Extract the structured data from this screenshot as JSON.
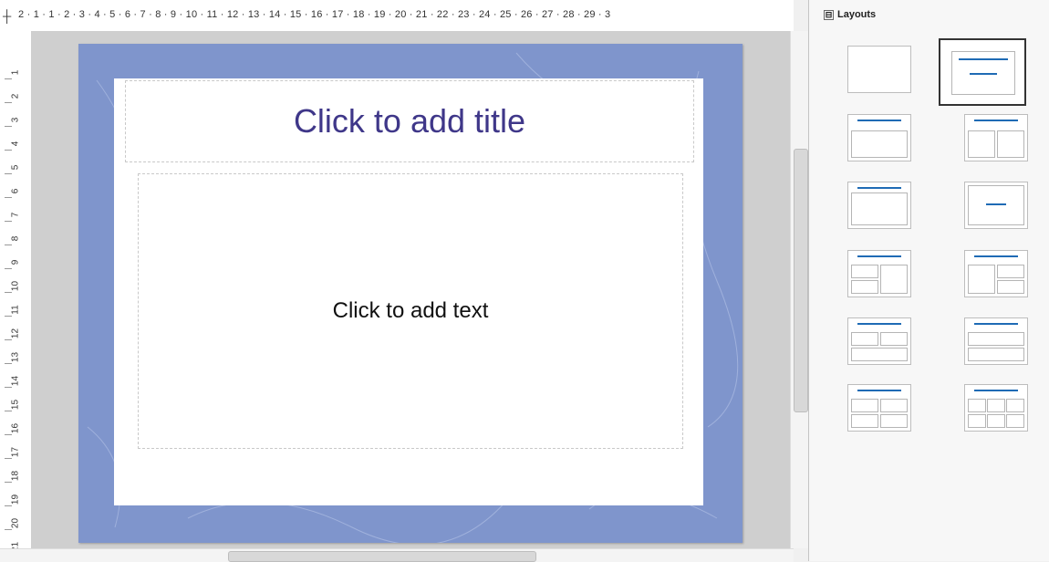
{
  "slide": {
    "title_placeholder": "Click to add title",
    "content_placeholder": "Click to add text"
  },
  "rulers": {
    "horizontal_labels": [
      "2",
      "1",
      "1",
      "2",
      "3",
      "4",
      "5",
      "6",
      "7",
      "8",
      "9",
      "10",
      "11",
      "12",
      "13",
      "14",
      "15",
      "16",
      "17",
      "18",
      "19",
      "20",
      "21",
      "22",
      "23",
      "24",
      "25",
      "26",
      "27",
      "28",
      "29",
      "3"
    ],
    "vertical_labels": [
      "1",
      "2",
      "3",
      "4",
      "5",
      "6",
      "7",
      "8",
      "9",
      "10",
      "11",
      "12",
      "13",
      "14",
      "15",
      "16",
      "17",
      "18",
      "19",
      "20",
      "21"
    ]
  },
  "sidebar": {
    "header": "Layouts",
    "toggle_symbol": "⊟",
    "layouts": [
      {
        "name": "blank"
      },
      {
        "name": "title-content"
      },
      {
        "name": "title-content-2"
      },
      {
        "name": "title-2-content"
      },
      {
        "name": "title-only"
      },
      {
        "name": "centered-text"
      },
      {
        "name": "title-2content-over-content"
      },
      {
        "name": "title-content-2content"
      },
      {
        "name": "title-2content-content"
      },
      {
        "name": "title-content-over-content"
      },
      {
        "name": "title-4content"
      },
      {
        "name": "title-6content"
      }
    ]
  },
  "colors": {
    "title": "#3f3789",
    "slide_background": "#7f95cc",
    "accent": "#1f6bb5"
  }
}
